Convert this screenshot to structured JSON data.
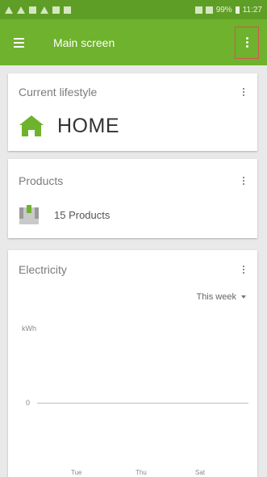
{
  "status_bar": {
    "time": "11:27",
    "battery": "99%"
  },
  "app_bar": {
    "title": "Main screen",
    "menu_icon": "hamburger-icon",
    "overflow_icon": "more-vert-icon"
  },
  "lifestyle": {
    "title": "Current lifestyle",
    "value": "HOME",
    "icon": "home-icon"
  },
  "products": {
    "title": "Products",
    "value": "15 Products",
    "icon": "box-icon"
  },
  "electricity": {
    "title": "Electricity",
    "period": "This week",
    "unit": "kWh",
    "zero_label": "0",
    "x_ticks": [
      "Tue",
      "Thu",
      "Sat"
    ]
  },
  "colors": {
    "accent": "#6fb22d",
    "status_bar": "#5f9e26",
    "highlight": "#d9534f"
  }
}
